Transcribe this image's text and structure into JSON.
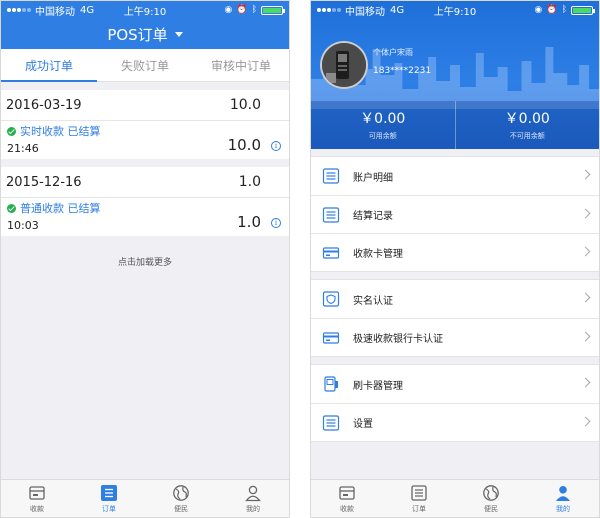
{
  "status": {
    "carrier": "中国移动",
    "network": "4G",
    "time": "上午9:10"
  },
  "left": {
    "nav_title": "POS订单",
    "tabs": [
      {
        "label": "成功订单"
      },
      {
        "label": "失败订单"
      },
      {
        "label": "审核中订单"
      }
    ],
    "orders": [
      {
        "date": "2016-03-19",
        "amount": "10.0",
        "status": "实时收款 已结算",
        "time": "21:46",
        "amount2": "10.0"
      },
      {
        "date": "2015-12-16",
        "amount": "1.0",
        "status": "普通收款 已结算",
        "time": "10:03",
        "amount2": "1.0"
      }
    ],
    "load_more": "点击加载更多"
  },
  "right": {
    "profile": {
      "name": "个体户宋雨",
      "phone": "183****2231"
    },
    "balances": [
      {
        "value": "￥0.00",
        "label": "可用余额"
      },
      {
        "value": "￥0.00",
        "label": "不可用余额"
      }
    ],
    "menu": [
      {
        "label": "账户明细"
      },
      {
        "label": "结算记录"
      },
      {
        "label": "收款卡管理"
      },
      {
        "label": "实名认证"
      },
      {
        "label": "极速收款银行卡认证"
      },
      {
        "label": "刷卡器管理"
      },
      {
        "label": "设置"
      }
    ]
  },
  "bottom_nav": [
    {
      "label": "收款"
    },
    {
      "label": "订单"
    },
    {
      "label": "便民"
    },
    {
      "label": "我的"
    }
  ],
  "colors": {
    "accent": "#2f7ee3",
    "success": "#23b14d",
    "battery": "#4cd964"
  },
  "battery_level": 1.0
}
